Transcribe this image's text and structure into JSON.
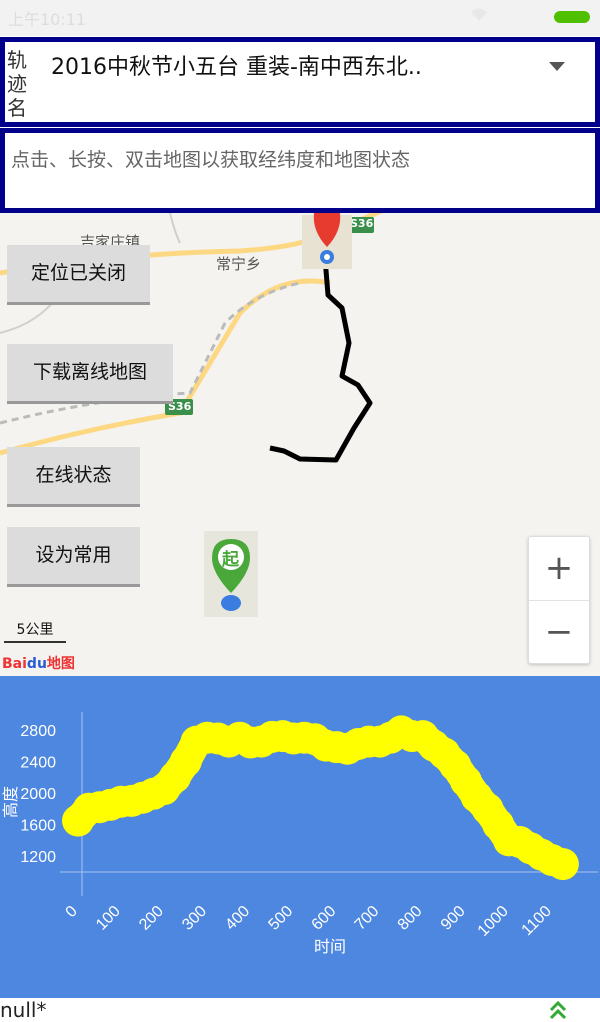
{
  "status_bar": {
    "time": "上午10:11"
  },
  "track": {
    "label": "轨迹名",
    "value": "2016中秋节小五台  重装-南中西东北.."
  },
  "hint": {
    "text": "点击、长按、双击地图以获取经纬度和地图状态"
  },
  "map": {
    "labels": {
      "town": "吉家庄镇",
      "township": "常宁乡",
      "road_top": "S36",
      "road_mid": "S36"
    },
    "start_marker": "起",
    "buttons": {
      "location": "定位已关闭",
      "download": "下载离线地图",
      "online": "在线状态",
      "favorite": "设为常用"
    },
    "zoom_in": "+",
    "zoom_out": "−",
    "scale": "5公里",
    "logo": {
      "bai": "Bai",
      "du": "du",
      "map": "地图"
    }
  },
  "colors": {
    "chart_bg": "#4e87e0",
    "series": "#ffff00",
    "frame": "#00008b"
  },
  "chart_data": {
    "type": "line",
    "xlabel": "时间",
    "ylabel": "高度",
    "x_ticks": [
      0,
      100,
      200,
      300,
      400,
      500,
      600,
      700,
      800,
      900,
      1000,
      1100
    ],
    "y_ticks": [
      1200,
      1600,
      2000,
      2400,
      2800
    ],
    "xlim": [
      0,
      1160
    ],
    "ylim": [
      1000,
      3000
    ],
    "series": [
      {
        "points": [
          [
            0,
            1650
          ],
          [
            25,
            1800
          ],
          [
            50,
            1820
          ],
          [
            75,
            1850
          ],
          [
            100,
            1890
          ],
          [
            125,
            1900
          ],
          [
            150,
            1940
          ],
          [
            175,
            1990
          ],
          [
            200,
            2050
          ],
          [
            225,
            2200
          ],
          [
            250,
            2400
          ],
          [
            275,
            2650
          ],
          [
            300,
            2700
          ],
          [
            325,
            2690
          ],
          [
            350,
            2650
          ],
          [
            375,
            2700
          ],
          [
            400,
            2640
          ],
          [
            425,
            2650
          ],
          [
            450,
            2710
          ],
          [
            475,
            2720
          ],
          [
            500,
            2690
          ],
          [
            525,
            2700
          ],
          [
            550,
            2680
          ],
          [
            575,
            2600
          ],
          [
            600,
            2580
          ],
          [
            625,
            2560
          ],
          [
            650,
            2620
          ],
          [
            675,
            2650
          ],
          [
            700,
            2650
          ],
          [
            725,
            2700
          ],
          [
            750,
            2780
          ],
          [
            775,
            2720
          ],
          [
            800,
            2720
          ],
          [
            825,
            2600
          ],
          [
            850,
            2500
          ],
          [
            875,
            2350
          ],
          [
            900,
            2150
          ],
          [
            925,
            1950
          ],
          [
            950,
            1800
          ],
          [
            975,
            1600
          ],
          [
            1000,
            1400
          ],
          [
            1025,
            1380
          ],
          [
            1050,
            1300
          ],
          [
            1075,
            1220
          ],
          [
            1100,
            1150
          ],
          [
            1125,
            1100
          ]
        ]
      }
    ]
  },
  "footer": {
    "text": "null*"
  }
}
